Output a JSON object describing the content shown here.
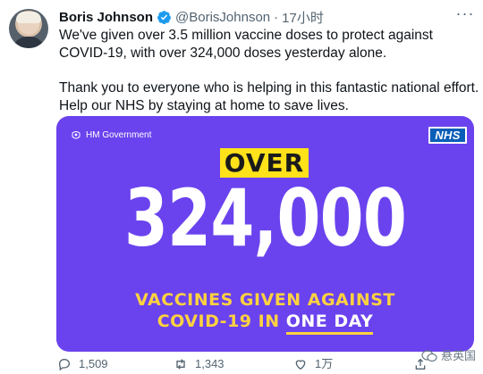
{
  "tweet": {
    "author_name": "Boris Johnson",
    "handle": "@BorisJohnson",
    "separator": "·",
    "time": "17小时",
    "more_label": "···",
    "paragraphs": [
      "We've given over 3.5 million vaccine doses to protect against COVID-19, with over 324,000 doses yesterday alone.",
      "Thank you to everyone who is helping in this fantastic national effort. Help our NHS by staying at home to save lives."
    ]
  },
  "media": {
    "government_label": "HM Government",
    "nhs_logo": "NHS",
    "over_label": "OVER",
    "big_number": "324,000",
    "caption_line1": "VACCINES GIVEN AGAINST",
    "caption_line2_prefix": "COVID-19 IN ",
    "caption_line2_highlight": "ONE DAY",
    "colors": {
      "background": "#6a43ee",
      "over_box": "#ffe21a",
      "caption": "#ffd23f",
      "nhs_blue": "#0a5eb8"
    }
  },
  "actions": {
    "reply_count": "1,509",
    "retweet_count": "1,343",
    "like_count": "1万",
    "icons": [
      "reply-icon",
      "retweet-icon",
      "like-icon",
      "share-icon"
    ]
  },
  "watermark": {
    "text": "悬英国"
  }
}
